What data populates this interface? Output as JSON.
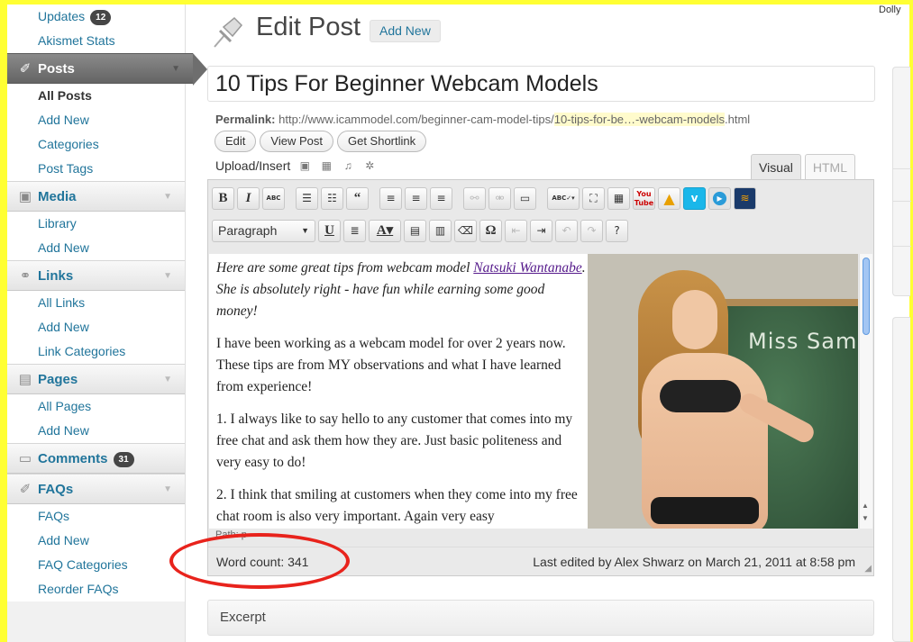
{
  "sidebar": {
    "items": [
      {
        "type": "sub",
        "label": "Updates",
        "badge": "12"
      },
      {
        "type": "sub",
        "label": "Akismet Stats"
      },
      {
        "type": "head",
        "label": "Posts",
        "icon": "pin-icon",
        "active": true
      },
      {
        "type": "sub",
        "label": "All Posts",
        "current": true
      },
      {
        "type": "sub",
        "label": "Add New"
      },
      {
        "type": "sub",
        "label": "Categories"
      },
      {
        "type": "sub",
        "label": "Post Tags"
      },
      {
        "type": "head",
        "label": "Media",
        "icon": "media-icon"
      },
      {
        "type": "sub",
        "label": "Library"
      },
      {
        "type": "sub",
        "label": "Add New"
      },
      {
        "type": "head",
        "label": "Links",
        "icon": "links-icon"
      },
      {
        "type": "sub",
        "label": "All Links"
      },
      {
        "type": "sub",
        "label": "Add New"
      },
      {
        "type": "sub",
        "label": "Link Categories"
      },
      {
        "type": "head",
        "label": "Pages",
        "icon": "pages-icon"
      },
      {
        "type": "sub",
        "label": "All Pages"
      },
      {
        "type": "sub",
        "label": "Add New"
      },
      {
        "type": "head",
        "label": "Comments",
        "icon": "comments-icon",
        "badge": "31"
      },
      {
        "type": "head",
        "label": "FAQs",
        "icon": "faq-pin-icon"
      },
      {
        "type": "sub",
        "label": "FAQs"
      },
      {
        "type": "sub",
        "label": "Add New"
      },
      {
        "type": "sub",
        "label": "FAQ Categories"
      },
      {
        "type": "sub",
        "label": "Reorder FAQs"
      }
    ]
  },
  "header": {
    "title": "Edit Post",
    "add_new": "Add New",
    "top_right": "Dolly"
  },
  "post": {
    "title": "10 Tips For Beginner Webcam Models",
    "permalink_label": "Permalink:",
    "permalink_base": "http://www.icammodel.com/beginner-cam-model-tips/",
    "permalink_slug": "10-tips-for-be…-webcam-models",
    "permalink_ext": ".html",
    "buttons": {
      "edit": "Edit",
      "view": "View Post",
      "shortlink": "Get Shortlink"
    }
  },
  "editor": {
    "upload_label": "Upload/Insert",
    "tabs": {
      "visual": "Visual",
      "html": "HTML"
    },
    "format_select": "Paragraph",
    "content": {
      "intro_pre": "Here are some great tips from webcam model ",
      "intro_link": "Natsuki Wantanabe",
      "intro_post": ". She is absolutely right - have fun while earning some good money!",
      "p1": "I have been working as a webcam model for over 2 years now. These tips are from MY observations and what I have learned from experience!",
      "p2": "1. I always like to say hello to any customer that comes into my free chat and ask them how they are. Just basic politeness and very easy to do!",
      "p3": "2. I think that smiling at customers when they come into my free chat room is also very important. Again very easy"
    },
    "image_board_text": "Miss Sam",
    "path": "Path: p",
    "word_count": "Word count: 341",
    "last_edited": "Last edited by Alex Shwarz on March 21, 2011 at 8:58 pm"
  },
  "excerpt": {
    "title": "Excerpt"
  },
  "colors": {
    "frame": "#ffff33",
    "link": "#21759b",
    "highlight_ring": "#e8231c"
  }
}
